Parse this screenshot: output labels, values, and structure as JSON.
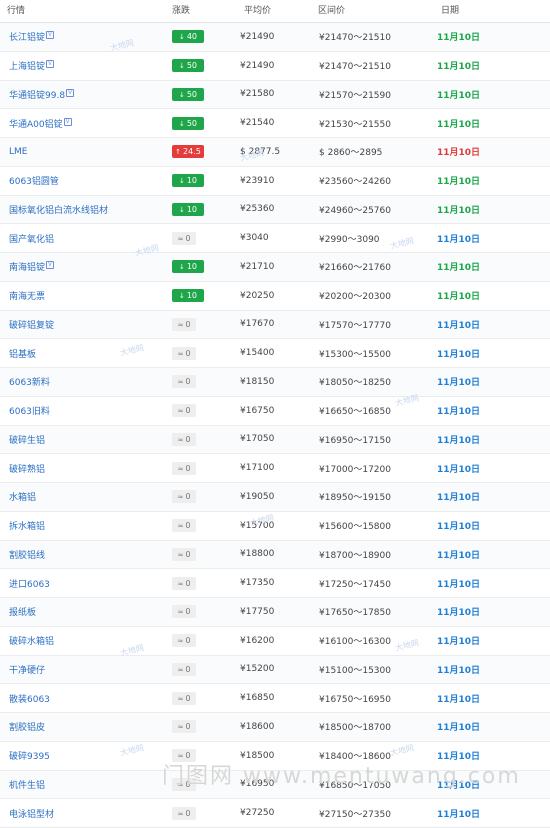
{
  "headers": [
    "行情",
    "涨跌",
    "平均价",
    "区间价",
    "日期"
  ],
  "rows": [
    {
      "name": "长江铝锭",
      "vip": true,
      "change": "40",
      "dir": "down",
      "avg": "¥21490",
      "range": "¥21470～21510",
      "date": "11月10日",
      "date_color": "green"
    },
    {
      "name": "上海铝锭",
      "vip": true,
      "change": "50",
      "dir": "down",
      "avg": "¥21490",
      "range": "¥21470～21510",
      "date": "11月10日",
      "date_color": "green"
    },
    {
      "name": "华通铝锭99.8",
      "vip": true,
      "change": "50",
      "dir": "down",
      "avg": "¥21580",
      "range": "¥21570～21590",
      "date": "11月10日",
      "date_color": "green"
    },
    {
      "name": "华通A00铝锭",
      "vip": true,
      "change": "50",
      "dir": "down",
      "avg": "¥21540",
      "range": "¥21530～21550",
      "date": "11月10日",
      "date_color": "green"
    },
    {
      "name": "LME",
      "vip": false,
      "change": "24.5",
      "dir": "up",
      "avg": "$ 2877.5",
      "range": "$ 2860～2895",
      "date": "11月10日",
      "date_color": "red"
    },
    {
      "name": "6063铝圆管",
      "vip": false,
      "change": "10",
      "dir": "down",
      "avg": "¥23910",
      "range": "¥23560～24260",
      "date": "11月10日",
      "date_color": "green"
    },
    {
      "name": "国标氧化铝白流水线铝材",
      "vip": false,
      "change": "10",
      "dir": "down",
      "avg": "¥25360",
      "range": "¥24960～25760",
      "date": "11月10日",
      "date_color": "green"
    },
    {
      "name": "国产氧化铝",
      "vip": false,
      "change": "0",
      "dir": "flat",
      "avg": "¥3040",
      "range": "¥2990～3090",
      "date": "11月10日",
      "date_color": "blue"
    },
    {
      "name": "南海铝锭",
      "vip": true,
      "change": "10",
      "dir": "down",
      "avg": "¥21710",
      "range": "¥21660～21760",
      "date": "11月10日",
      "date_color": "green"
    },
    {
      "name": "南海无票",
      "vip": false,
      "change": "10",
      "dir": "down",
      "avg": "¥20250",
      "range": "¥20200～20300",
      "date": "11月10日",
      "date_color": "green"
    },
    {
      "name": "破碎铝复锭",
      "vip": false,
      "change": "0",
      "dir": "flat",
      "avg": "¥17670",
      "range": "¥17570～17770",
      "date": "11月10日",
      "date_color": "blue"
    },
    {
      "name": "铝基板",
      "vip": false,
      "change": "0",
      "dir": "flat",
      "avg": "¥15400",
      "range": "¥15300～15500",
      "date": "11月10日",
      "date_color": "blue"
    },
    {
      "name": "6063新料",
      "vip": false,
      "change": "0",
      "dir": "flat",
      "avg": "¥18150",
      "range": "¥18050～18250",
      "date": "11月10日",
      "date_color": "blue"
    },
    {
      "name": "6063旧料",
      "vip": false,
      "change": "0",
      "dir": "flat",
      "avg": "¥16750",
      "range": "¥16650～16850",
      "date": "11月10日",
      "date_color": "blue"
    },
    {
      "name": "破碎生铝",
      "vip": false,
      "change": "0",
      "dir": "flat",
      "avg": "¥17050",
      "range": "¥16950～17150",
      "date": "11月10日",
      "date_color": "blue"
    },
    {
      "name": "破碎熟铝",
      "vip": false,
      "change": "0",
      "dir": "flat",
      "avg": "¥17100",
      "range": "¥17000～17200",
      "date": "11月10日",
      "date_color": "blue"
    },
    {
      "name": "水箱铝",
      "vip": false,
      "change": "0",
      "dir": "flat",
      "avg": "¥19050",
      "range": "¥18950～19150",
      "date": "11月10日",
      "date_color": "blue"
    },
    {
      "name": "拆水箱铝",
      "vip": false,
      "change": "0",
      "dir": "flat",
      "avg": "¥15700",
      "range": "¥15600～15800",
      "date": "11月10日",
      "date_color": "blue"
    },
    {
      "name": "割胶铝线",
      "vip": false,
      "change": "0",
      "dir": "flat",
      "avg": "¥18800",
      "range": "¥18700～18900",
      "date": "11月10日",
      "date_color": "blue"
    },
    {
      "name": "进口6063",
      "vip": false,
      "change": "0",
      "dir": "flat",
      "avg": "¥17350",
      "range": "¥17250～17450",
      "date": "11月10日",
      "date_color": "blue"
    },
    {
      "name": "报纸板",
      "vip": false,
      "change": "0",
      "dir": "flat",
      "avg": "¥17750",
      "range": "¥17650～17850",
      "date": "11月10日",
      "date_color": "blue"
    },
    {
      "name": "破碎水箱铝",
      "vip": false,
      "change": "0",
      "dir": "flat",
      "avg": "¥16200",
      "range": "¥16100～16300",
      "date": "11月10日",
      "date_color": "blue"
    },
    {
      "name": "干净硬仔",
      "vip": false,
      "change": "0",
      "dir": "flat",
      "avg": "¥15200",
      "range": "¥15100～15300",
      "date": "11月10日",
      "date_color": "blue"
    },
    {
      "name": "散装6063",
      "vip": false,
      "change": "0",
      "dir": "flat",
      "avg": "¥16850",
      "range": "¥16750～16950",
      "date": "11月10日",
      "date_color": "blue"
    },
    {
      "name": "割胶铝皮",
      "vip": false,
      "change": "0",
      "dir": "flat",
      "avg": "¥18600",
      "range": "¥18500～18700",
      "date": "11月10日",
      "date_color": "blue"
    },
    {
      "name": "破碎9395",
      "vip": false,
      "change": "0",
      "dir": "flat",
      "avg": "¥18500",
      "range": "¥18400～18600",
      "date": "11月10日",
      "date_color": "blue"
    },
    {
      "name": "机件生铝",
      "vip": false,
      "change": "0",
      "dir": "flat",
      "avg": "¥16950",
      "range": "¥16850～17050",
      "date": "11月10日",
      "date_color": "blue"
    },
    {
      "name": "电泳铝型材",
      "vip": false,
      "change": "0",
      "dir": "flat",
      "avg": "¥27250",
      "range": "¥27150～27350",
      "date": "11月10日",
      "date_color": "blue"
    }
  ],
  "watermark": "大地网",
  "footer_watermark": "门图网 www.mentuwang.com",
  "arrows": {
    "down": "↓",
    "up": "↑",
    "flat": "≈"
  }
}
